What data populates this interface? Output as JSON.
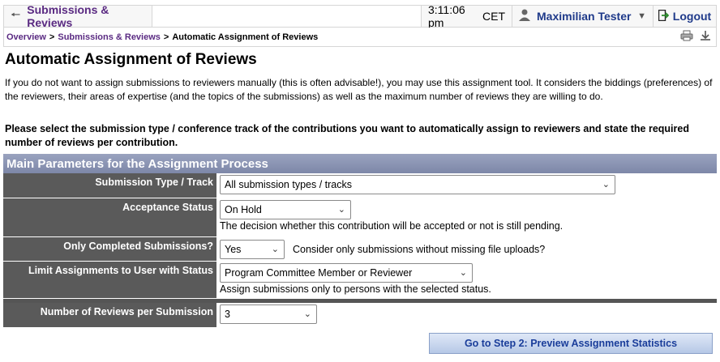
{
  "topbar": {
    "back_label": "Submissions & Reviews",
    "time": "3:11:06 pm",
    "timezone": "CET",
    "user_name": "Maximilian Tester",
    "logout_label": "Logout"
  },
  "breadcrumb": {
    "items": [
      "Overview",
      "Submissions & Reviews"
    ],
    "current": "Automatic Assignment of Reviews"
  },
  "page": {
    "title": "Automatic Assignment of Reviews",
    "intro": "If you do not want to assign submissions to reviewers manually (this is often advisable!), you may use this assignment tool. It considers the biddings (preferences) of the reviewers, their areas of expertise (and the topics of the submissions) as well as the maximum number of reviews they are willing to do.",
    "instruction": "Please select the submission type / conference track of the contributions you want to automatically assign to reviewers and state the required number of reviews per contribution."
  },
  "form": {
    "section_title": "Main Parameters for the Assignment Process",
    "submission_type": {
      "label": "Submission Type / Track",
      "value": "All submission types / tracks"
    },
    "acceptance_status": {
      "label": "Acceptance Status",
      "value": "On Hold",
      "hint": "The decision whether this contribution will be accepted or not is still pending."
    },
    "only_completed": {
      "label": "Only Completed Submissions?",
      "value": "Yes",
      "hint": "Consider only submissions without missing file uploads?"
    },
    "limit_user_status": {
      "label": "Limit Assignments to User with Status",
      "value": "Program Committee Member or Reviewer",
      "hint": "Assign submissions only to persons with the selected status."
    },
    "reviews_per_submission": {
      "label": "Number of Reviews per Submission",
      "value": "3"
    },
    "next_button": "Go to Step 2: Preview Assignment Statistics"
  },
  "colors": {
    "accent_purple": "#5a2a82",
    "link_blue": "#1f3a8a",
    "label_bg": "#5a5a5a",
    "section_bg": "#8a93b2"
  }
}
